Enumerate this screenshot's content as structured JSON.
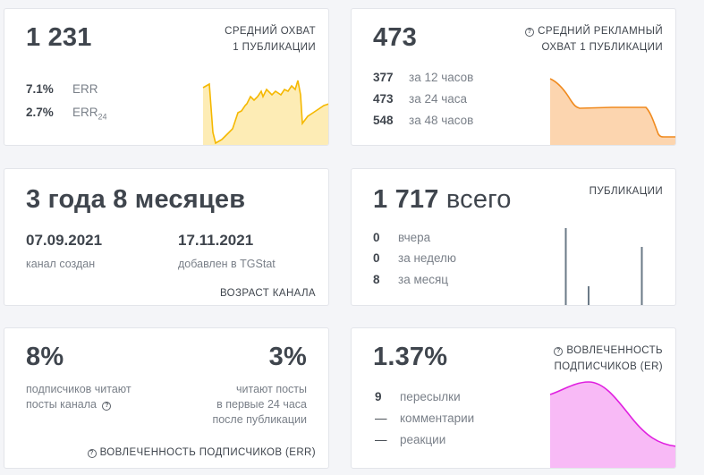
{
  "card_reach": {
    "value": "1 231",
    "header_line1": "СРЕДНИЙ ОХВАТ",
    "header_line2": "1 ПУБЛИКАЦИИ",
    "stats": [
      {
        "value": "7.1%",
        "label": "ERR",
        "sub": ""
      },
      {
        "value": "2.7%",
        "label": "ERR",
        "sub": "24"
      }
    ],
    "colors": {
      "line": "#f5b800",
      "fill": "#fde9a8"
    }
  },
  "card_ad_reach": {
    "value": "473",
    "header_line1": "СРЕДНИЙ РЕКЛАМНЫЙ",
    "header_line2": "ОХВАТ 1 ПУБЛИКАЦИИ",
    "icon": "info-circle-icon",
    "stats": [
      {
        "value": "377",
        "label": "за 12 часов"
      },
      {
        "value": "473",
        "label": "за 24 часа"
      },
      {
        "value": "548",
        "label": "за 48 часов"
      }
    ],
    "colors": {
      "line": "#f08a1e",
      "fill": "#fcd0a6"
    }
  },
  "card_age": {
    "value": "3 года 8 месяцев",
    "created_date": "07.09.2021",
    "created_label": "канал создан",
    "added_date": "17.11.2021",
    "added_label": "добавлен в TGStat",
    "footer": "ВОЗРАСТ КАНАЛА"
  },
  "card_posts": {
    "value": "1 717",
    "value_suffix": "всего",
    "header": "ПУБЛИКАЦИИ",
    "stats": [
      {
        "value": "0",
        "label": "вчера"
      },
      {
        "value": "0",
        "label": "за неделю"
      },
      {
        "value": "8",
        "label": "за месяц"
      }
    ],
    "colors": {
      "bars": "#6b7a87"
    }
  },
  "card_err": {
    "left_value": "8%",
    "left_label_line1": "подписчиков читают",
    "left_label_line2": "посты канала",
    "right_value": "3%",
    "right_label_line1": "читают посты",
    "right_label_line2": "в первые 24 часа",
    "right_label_line3": "после публикации",
    "footer": "ВОВЛЕЧЕННОСТЬ ПОДПИСЧИКОВ (ERR)",
    "icon": "info-circle-icon"
  },
  "card_er": {
    "value": "1.37%",
    "header_line1": "ВОВЛЕЧЕННОСТЬ",
    "header_line2": "ПОДПИСЧИКОВ (ER)",
    "icon": "info-circle-icon",
    "stats": [
      {
        "value": "9",
        "label": "пересылки"
      },
      {
        "value": "—",
        "label": "комментарии"
      },
      {
        "value": "—",
        "label": "реакции"
      }
    ],
    "colors": {
      "line": "#e020e0",
      "fill": "#f7b2f5"
    }
  }
}
